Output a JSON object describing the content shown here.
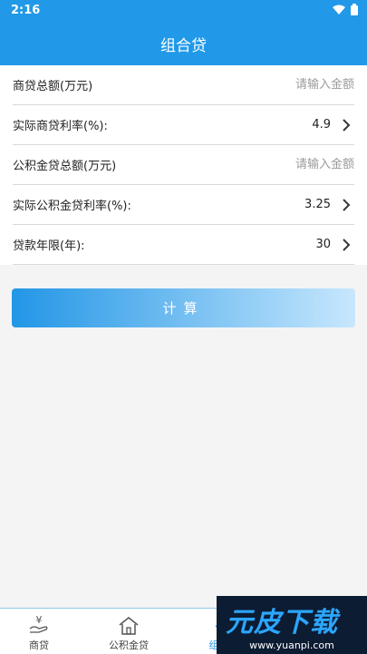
{
  "status": {
    "time": "2:16"
  },
  "header": {
    "title": "组合贷"
  },
  "form": {
    "commercial_amount": {
      "label": "商贷总额(万元)",
      "placeholder": "请输入金额"
    },
    "commercial_rate": {
      "label": "实际商贷利率(%):",
      "value": "4.9"
    },
    "fund_amount": {
      "label": "公积金贷总额(万元)",
      "placeholder": "请输入金额"
    },
    "fund_rate": {
      "label": "实际公积金贷利率(%):",
      "value": "3.25"
    },
    "term": {
      "label": "贷款年限(年):",
      "value": "30"
    }
  },
  "button": {
    "label": "计算"
  },
  "tabs": [
    {
      "label": "商贷",
      "icon": "yuan-hand-icon"
    },
    {
      "label": "公积金贷",
      "icon": "house-icon"
    },
    {
      "label": "组合贷",
      "icon": "combo-icon"
    },
    {
      "label": "",
      "icon": ""
    }
  ],
  "watermark": {
    "main": "元皮下载",
    "url": "www.yuanpi.com"
  },
  "colors": {
    "primary": "#2199e8",
    "button_end": "#c7e7fd",
    "background": "#f4f4f4"
  }
}
